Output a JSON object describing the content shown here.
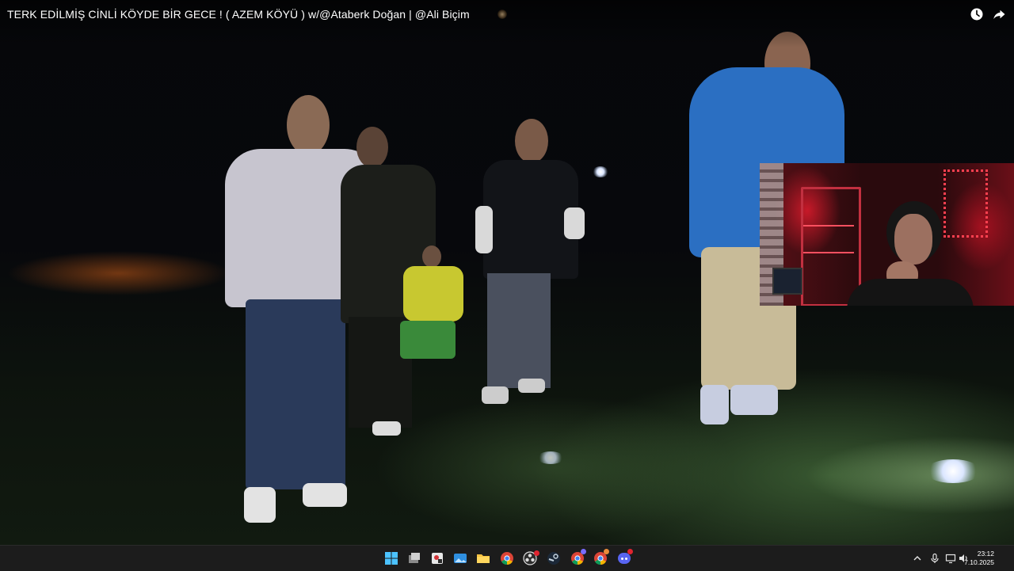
{
  "video": {
    "title": "TERK EDİLMİŞ CİNLİ KÖYDE BİR GECE ! ( AZEM KÖYÜ ) w/@Ataberk Doğan | @Ali Biçim",
    "top_icons": [
      "watch-later-icon",
      "share-icon"
    ]
  },
  "taskbar": {
    "pinned_apps": [
      "windows-start-icon",
      "task-view-icon",
      "snipping-tool-icon",
      "photos-icon",
      "file-explorer-icon",
      "chrome-icon",
      "obs-icon",
      "steam-icon",
      "chrome-profile-icon",
      "chrome-profile-2-icon",
      "discord-icon"
    ],
    "tray_icons": [
      "chevron-up-icon",
      "microphone-icon",
      "display-icon",
      "speaker-icon"
    ],
    "time": "23:12",
    "date": "7.10.2025"
  },
  "colors": {
    "taskbar_bg": "#1c1c1c",
    "title_text": "#ffffff",
    "webcam_accent": "#ff2030"
  }
}
